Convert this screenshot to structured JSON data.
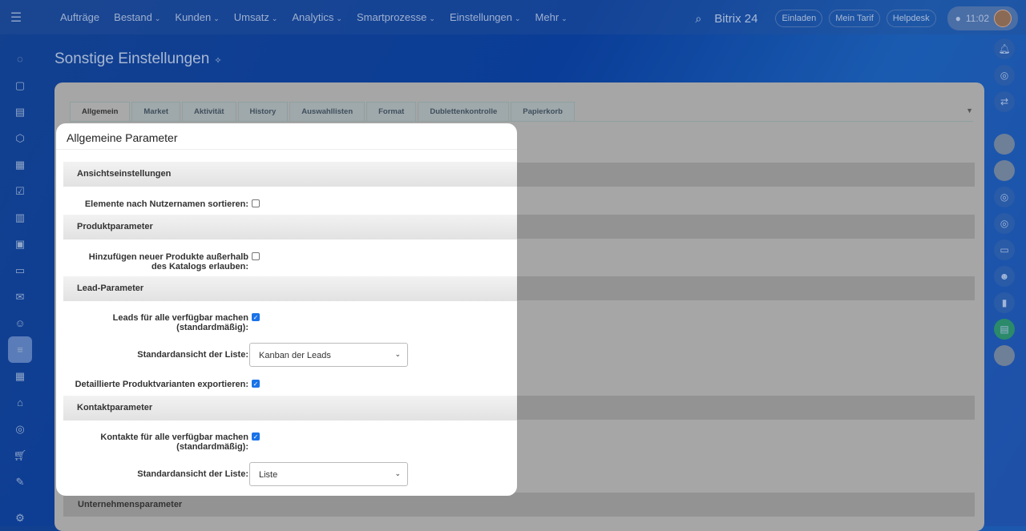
{
  "topbar": {
    "nav": [
      "Aufträge",
      "Bestand",
      "Kunden",
      "Umsatz",
      "Analytics",
      "Smartprozesse",
      "Einstellungen",
      "Mehr"
    ],
    "brand": "Bitrix 24",
    "invite": "Einladen",
    "plan": "Mein Tarif",
    "helpdesk": "Helpdesk",
    "time": "11:02"
  },
  "page": {
    "title": "Sonstige Einstellungen"
  },
  "tabs": [
    "Allgemein",
    "Market",
    "Aktivität",
    "History",
    "Auswahllisten",
    "Format",
    "Dublettenkontrolle",
    "Papierkorb"
  ],
  "panel": {
    "title": "Allgemeine Parameter",
    "sections": {
      "view": "Ansichtseinstellungen",
      "product": "Produktparameter",
      "lead": "Lead-Parameter",
      "contact": "Kontaktparameter",
      "company": "Unternehmensparameter"
    },
    "fields": {
      "sort_by_name": {
        "label": "Elemente nach Nutzernamen sortieren:",
        "checked": false
      },
      "add_products": {
        "label1": "Hinzufügen neuer Produkte außerhalb",
        "label2": "des Katalogs erlauben:",
        "checked": false
      },
      "leads_available": {
        "label1": "Leads für alle verfügbar machen",
        "label2": "(standardmäßig):",
        "checked": true
      },
      "lead_view": {
        "label": "Standardansicht der Liste:",
        "value": "Kanban der Leads"
      },
      "export_variants": {
        "label": "Detaillierte Produktvarianten exportieren:",
        "checked": true
      },
      "contacts_available": {
        "label1": "Kontakte für alle verfügbar machen",
        "label2": "(standardmäßig):",
        "checked": true
      },
      "contact_view": {
        "label": "Standardansicht der Liste:",
        "value": "Liste"
      }
    }
  }
}
